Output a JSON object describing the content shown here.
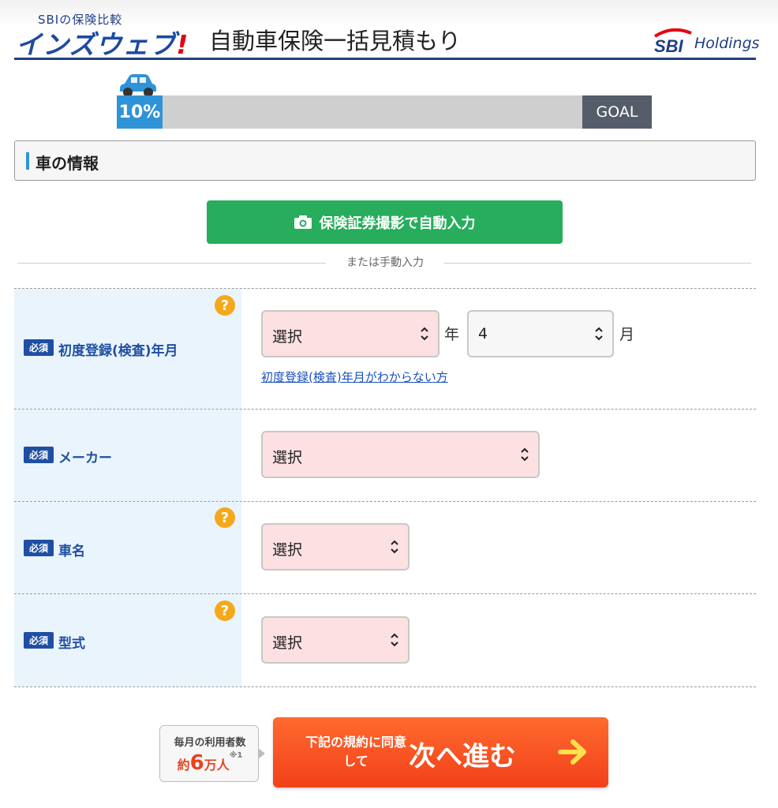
{
  "header": {
    "logo_sub": "SBIの保険比較",
    "logo_main": "インズウェブ",
    "logo_bang": "!",
    "page_title": "自動車保険一括見積もり",
    "partner_mark": "SBI",
    "partner_text": "Holdings",
    "brand_color": "#1f3f86"
  },
  "progress": {
    "percent_label": "10%",
    "value": 10,
    "goal_label": "GOAL"
  },
  "section": {
    "title": "車の情報"
  },
  "photo_button": {
    "label": "保険証券撮影で自動入力",
    "color": "#27ad5c"
  },
  "divider": {
    "text": "または手動入力"
  },
  "form": {
    "required_label": "必須",
    "rows": [
      {
        "label": "初度登録(検査)年月",
        "has_help": true,
        "year_select": "選択",
        "year_unit": "年",
        "month_select": "4",
        "month_unit": "月",
        "link": "初度登録(検査)年月がわからない方"
      },
      {
        "label": "メーカー",
        "has_help": false,
        "select": "選択"
      },
      {
        "label": "車名",
        "has_help": true,
        "select": "選択"
      },
      {
        "label": "型式",
        "has_help": true,
        "select": "選択"
      }
    ],
    "help_glyph": "?"
  },
  "cta": {
    "users_line1": "毎月の利用者数",
    "users_prefix": "約",
    "users_number": "6",
    "users_suffix": "万人",
    "users_note": "※1",
    "next_sub": "下記の規約に同意して",
    "next_main": "次へ進む",
    "button_color": "#f2401a"
  }
}
